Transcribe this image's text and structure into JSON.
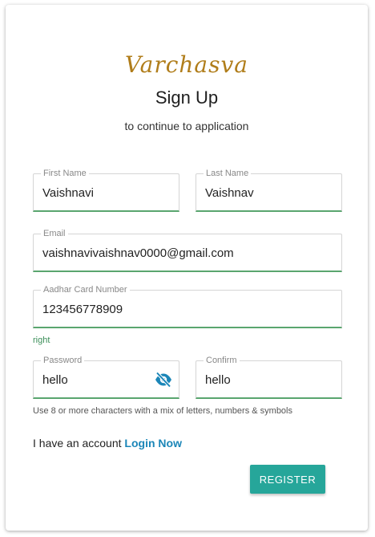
{
  "brand": {
    "logo_text": "Varchasva",
    "color": "#b07d1a"
  },
  "header": {
    "title": "Sign Up",
    "subtitle": "to continue to application"
  },
  "form": {
    "first_name": {
      "label": "First Name",
      "value": "Vaishnavi"
    },
    "last_name": {
      "label": "Last Name",
      "value": "Vaishnav"
    },
    "email": {
      "label": "Email",
      "value": "vaishnavivaishnav0000@gmail.com"
    },
    "aadhar": {
      "label": "Aadhar Card Number",
      "value": "123456778909",
      "validation": "right"
    },
    "password": {
      "label": "Password",
      "value": "hello",
      "toggle_icon": "eye-off-icon"
    },
    "confirm": {
      "label": "Confirm",
      "value": "hello"
    },
    "password_hint": "Use 8 or more characters with a mix of letters, numbers & symbols"
  },
  "footer": {
    "account_text": "I have an account",
    "login_link": "Login Now",
    "register_button": "REGISTER"
  },
  "colors": {
    "accent": "#26a69a",
    "link": "#1b86b8",
    "valid_underline": "#5aa66f",
    "valid_text": "#3c8f5a"
  }
}
